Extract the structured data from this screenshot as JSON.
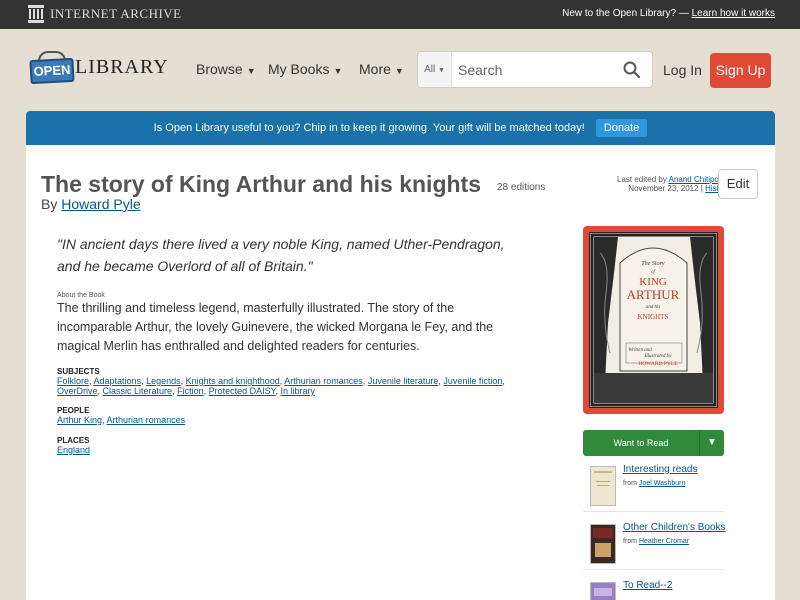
{
  "ia_bar": {
    "logo_text": "Internet Archive",
    "new_text": "New to the Open Library? —",
    "learn_link": "Learn how it works"
  },
  "header": {
    "logo_open": "OPEN",
    "logo_library": "LIBRARY",
    "nav": {
      "browse": "Browse",
      "my_books": "My Books",
      "more": "More"
    },
    "search": {
      "scope": "All",
      "placeholder": "Search"
    },
    "login": "Log In",
    "signup": "Sign Up"
  },
  "donate": {
    "text": "Is Open Library useful to you? Chip in to keep it growing. Your gift will be matched today!",
    "button": "Donate"
  },
  "book": {
    "title": "The story of King Arthur and his knights",
    "editions": "28 editions",
    "by": "By",
    "author": "Howard Pyle",
    "edit_prefix": "Last edited by",
    "edited_by": "Anand Chitipothu",
    "edit_date": "November 23, 2012 |",
    "history": "History",
    "edit_button": "Edit",
    "quote": "\"IN ancient days there lived a very noble King, named Uther-Pendragon, and he became Overlord of all of Britain.\"",
    "about_label": "About the Book",
    "about_text": "The thrilling and timeless legend, masterfully illustrated. The story of the incomparable Arthur, the lovely Guinevere, the wicked Morgana le Fey, and the magical Merlin has enthralled and delighted readers for centuries.",
    "subjects_label": "SUBJECTS",
    "subjects": [
      "Folklore",
      "Adaptations",
      "Legends",
      "Knights and knighthood",
      "Arthurian romances",
      "Juvenile literature",
      "Juvenile fiction",
      "OverDrive",
      "Classic Literature",
      "Fiction",
      "Protected DAISY",
      "In library"
    ],
    "people_label": "PEOPLE",
    "people": [
      "Arthur King",
      "Arthurian romances"
    ],
    "places_label": "PLACES",
    "places": [
      "England"
    ]
  },
  "cover": {
    "line1": "The Story",
    "line2": "of",
    "line3": "KING",
    "line4": "ARTHUR",
    "line5": "and his",
    "line6": "KNIGHTS",
    "line7": "Written and",
    "line8": "Illustrated by",
    "line9": "HOWARD PYLE"
  },
  "sidebar": {
    "want_to_read": "Want to Read",
    "lists": [
      {
        "name": "Interesting reads",
        "from": "from",
        "user": "Joel Washburn"
      },
      {
        "name": "Other Children's Books",
        "from": "from",
        "user": "Heather Cromar"
      },
      {
        "name": "To Read--2",
        "from": "",
        "user": ""
      }
    ]
  },
  "colors": {
    "accent_red": "#e14937",
    "donate_blue": "#1b71aa",
    "want_green": "#2f8a3a",
    "link": "#02598b"
  }
}
